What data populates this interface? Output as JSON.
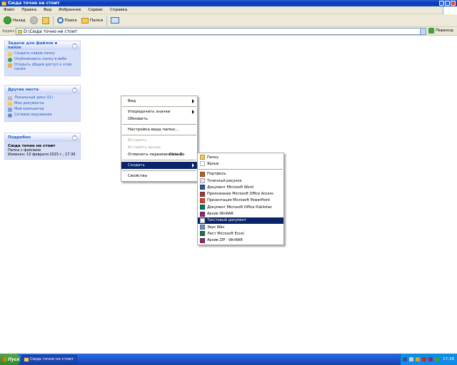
{
  "window": {
    "title": "Сюда точно не стоит"
  },
  "menubar": [
    "Файл",
    "Правка",
    "Вид",
    "Избранное",
    "Сервис",
    "Справка"
  ],
  "toolbar": {
    "back": "Назад",
    "search": "Поиск",
    "folders": "Папки"
  },
  "address": {
    "label": "Адрес:",
    "value": "D:\\Сюда точно не стоит",
    "go": "Переход"
  },
  "tasks_panel": {
    "title": "Задачи для файлов и папок",
    "items": [
      "Создать новую папку",
      "Опубликовать папку в вебе",
      "Открыть общий доступ к этой папке"
    ]
  },
  "places_panel": {
    "title": "Другие места",
    "items": [
      "Локальный диск (D:)",
      "Мои документы",
      "Мой компьютер",
      "Сетевое окружение"
    ]
  },
  "details_panel": {
    "title": "Подробно",
    "name": "Сюда точно не стоит",
    "type": "Папка с файлами",
    "modified": "Изменен: 10 февраля 2015 г., 17:36"
  },
  "context_menu": {
    "view": "Вид",
    "arrange": "Упорядочить значки",
    "refresh": "Обновить",
    "customize": "Настройка вида папки...",
    "paste": "Вставить",
    "paste_shortcut": "Вставить ярлык",
    "undo": "Отменить переименование",
    "undo_shortcut": "Ctrl+Z",
    "new": "Создать",
    "properties": "Свойства"
  },
  "submenu": {
    "folder": "Папку",
    "shortcut": "Ярлык",
    "items": [
      "Портфель",
      "Точечный рисунок",
      "Документ Microsoft Word",
      "Приложение Microsoft Office Access",
      "Презентация Microsoft PowerPoint",
      "Документ Microsoft Office Publisher",
      "Архив WinRAR",
      "Текстовый документ",
      "Звук Wav",
      "Лист Microsoft Excel",
      "Архив ZIP - WinRAR"
    ]
  },
  "taskbar": {
    "start": "Пуск",
    "task": "Сюда точно не стоит",
    "clock": "17:38"
  }
}
